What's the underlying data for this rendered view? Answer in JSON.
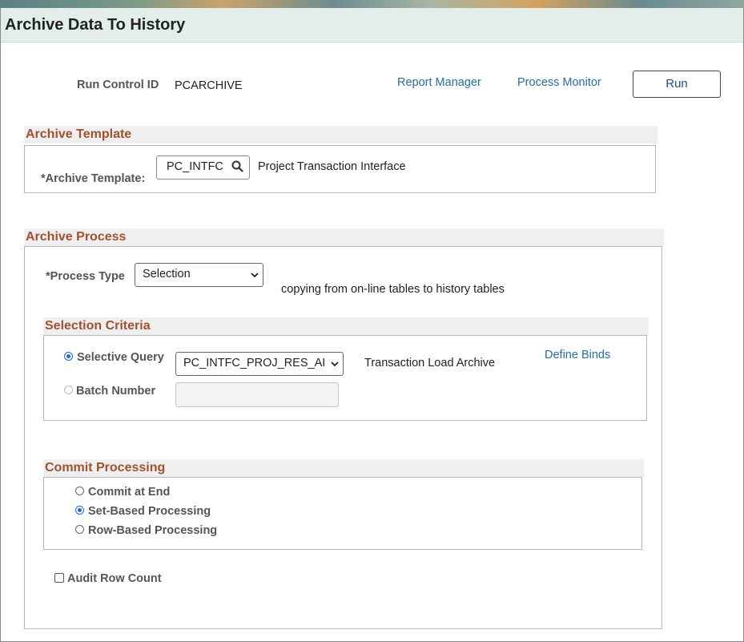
{
  "header": {
    "title": "Archive Data To History"
  },
  "run_control": {
    "label": "Run Control ID",
    "value": "PCARCHIVE",
    "report_manager": "Report Manager",
    "process_monitor": "Process Monitor",
    "run_button": "Run"
  },
  "archive_template": {
    "section_title": "Archive Template",
    "field_label": "*Archive Template:",
    "value": "PC_INTFC",
    "description": "Project Transaction Interface",
    "search_icon": "search-icon"
  },
  "archive_process": {
    "section_title": "Archive Process",
    "process_type_label": "*Process Type",
    "process_type_value": "Selection",
    "process_type_desc": "copying from on-line tables to history tables"
  },
  "selection_criteria": {
    "section_title": "Selection Criteria",
    "selective_query_label": "Selective Query",
    "selective_query_value": "PC_INTFC_PROJ_RES_AI",
    "query_desc": "Transaction Load Archive",
    "define_binds": "Define Binds",
    "batch_number_label": "Batch Number",
    "batch_number_value": ""
  },
  "commit_processing": {
    "section_title": "Commit Processing",
    "options": [
      "Commit at End",
      "Set-Based Processing",
      "Row-Based Processing"
    ],
    "selected": "Set-Based Processing"
  },
  "audit": {
    "label": "Audit Row Count",
    "checked": false
  },
  "colors": {
    "section_title": "#a0522d",
    "link": "#1f6fa8",
    "titlebar_bg": "#e3eeeb",
    "radio_selected": "#1a6bd6"
  }
}
